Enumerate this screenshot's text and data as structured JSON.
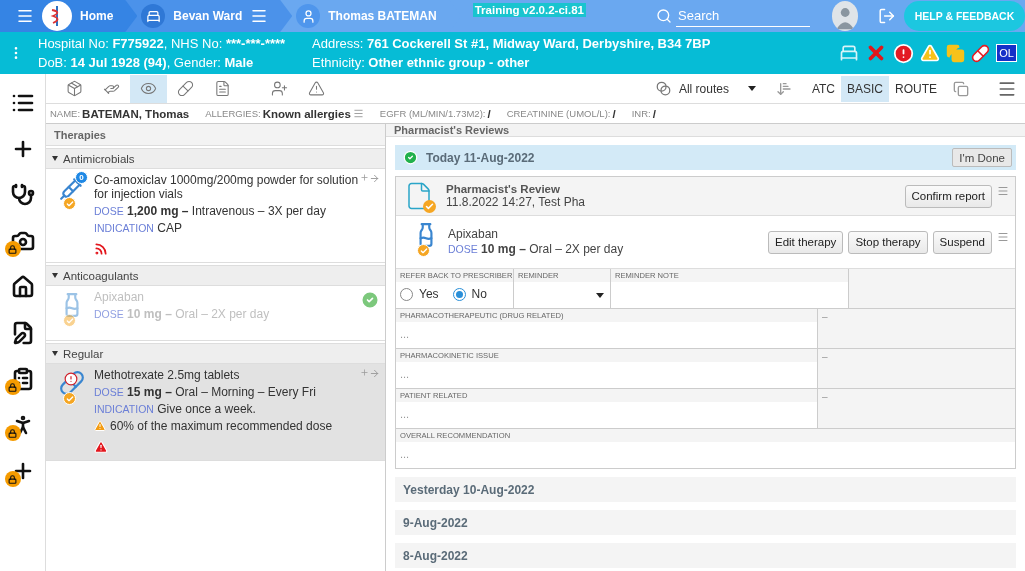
{
  "topbar": {
    "crumbs": [
      {
        "kind": "home",
        "label": "Home"
      },
      {
        "kind": "ward",
        "label": "Bevan Ward"
      },
      {
        "kind": "patient",
        "label": "Thomas BATEMAN"
      }
    ],
    "version": "Training v2.0.2-ci.81",
    "search": {
      "placeholder": "Search"
    },
    "help_button": "HELP & FEEDBACK"
  },
  "patient_bar": {
    "columns": [
      [
        [
          {
            "label": "Hospital No: ",
            "value": "F775922"
          },
          {
            "label": ", NHS No: ",
            "value": "***-***-****"
          }
        ],
        [
          {
            "label": "DoB: ",
            "value": "14 Jul 1928 (94)"
          },
          {
            "label": ", Gender: ",
            "value": "Male"
          }
        ]
      ],
      [
        [
          {
            "label": "Address: ",
            "value": "761 Cockerell St #1, Midway Ward, Derbyshire, B34 7BP"
          }
        ],
        [
          {
            "label": "Ethnicity: ",
            "value": "Other ethnic group - other"
          }
        ]
      ]
    ],
    "status_icons": [
      {
        "kind": "bed"
      },
      {
        "kind": "cross"
      },
      {
        "kind": "alert"
      },
      {
        "kind": "warning"
      },
      {
        "kind": "copies"
      },
      {
        "kind": "pill"
      },
      {
        "kind": "text",
        "label": "OL"
      }
    ]
  },
  "rail": [
    {
      "kind": "list",
      "locked": false
    },
    {
      "kind": "plus",
      "locked": false
    },
    {
      "kind": "stethoscope",
      "locked": false
    },
    {
      "kind": "camera",
      "locked": true
    },
    {
      "kind": "home",
      "locked": false
    },
    {
      "kind": "edit",
      "locked": false
    },
    {
      "kind": "clipboard",
      "locked": true
    },
    {
      "kind": "walker",
      "locked": true
    },
    {
      "kind": "plus",
      "locked": true
    }
  ],
  "toolbar": {
    "tools": [
      {
        "kind": "pillbox",
        "selected": false
      },
      {
        "kind": "hand",
        "selected": false
      },
      {
        "kind": "eye",
        "selected": true
      },
      {
        "kind": "pill",
        "selected": false
      },
      {
        "kind": "document",
        "selected": false
      },
      {
        "kind": "referral",
        "selected": false
      },
      {
        "kind": "warning",
        "selected": false
      }
    ],
    "route_filter": "All routes",
    "views": [
      {
        "label": "ATC",
        "selected": false
      },
      {
        "label": "BASIC",
        "selected": true
      },
      {
        "label": "ROUTE",
        "selected": false
      }
    ]
  },
  "info": [
    {
      "label": "NAME:",
      "value": "BATEMAN, Thomas",
      "menu": false
    },
    {
      "label": "ALLERGIES:",
      "value": "Known allergies",
      "menu": true
    },
    {
      "label": "EGFR (ML/MIN/1.73M2):",
      "value": "/",
      "menu": false
    },
    {
      "label": "CREATININE (UMOL/L):",
      "value": "/",
      "menu": false
    },
    {
      "label": "INR:",
      "value": "/",
      "menu": false
    }
  ],
  "therapies": {
    "title": "Therapies",
    "groups": [
      {
        "name": "Antimicrobials",
        "expanded": true,
        "items": [
          {
            "kind": "injection",
            "badge": "0",
            "alert": false,
            "name": "Co-amoxiclav 1000mg/200mg powder for solution for injection vials",
            "dose_label": "DOSE",
            "dose": "1,200 mg –",
            "schedule": "Intravenous – 3X per day",
            "indication_label": "INDICATION",
            "indication": "CAP",
            "flags": [
              {
                "kind": "signal"
              }
            ],
            "reviewed": false,
            "selected": false
          }
        ]
      },
      {
        "name": "Anticoagulants",
        "expanded": true,
        "items": [
          {
            "kind": "syrup",
            "alert": false,
            "name": "Apixaban",
            "dose_label": "DOSE",
            "dose": "10 mg –",
            "schedule": "Oral – 2X per day",
            "reviewed": true,
            "selected": false
          }
        ]
      },
      {
        "name": "Regular",
        "expanded": true,
        "items": [
          {
            "kind": "tablet",
            "alert": true,
            "name": "Methotrexate 2.5mg tablets",
            "dose_label": "DOSE",
            "dose": "15 mg –",
            "schedule": "Oral – Morning – Every Fri",
            "indication_label": "INDICATION",
            "indication": "Give once a week.",
            "warning": "60% of the maximum recommended dose",
            "flags": [
              {
                "kind": "warning"
              }
            ],
            "reviewed": false,
            "selected": true
          }
        ]
      }
    ]
  },
  "reviews": {
    "title": "Pharmacist's Reviews",
    "days": [
      {
        "label": "Today 11-Aug-2022",
        "expanded": true,
        "done": true,
        "done_button": "I'm Done",
        "review": {
          "title": "Pharmacist's Review",
          "meta": "11.8.2022 14:27, Test Pha",
          "confirm_button": "Confirm report",
          "medication": {
            "kind": "syrup",
            "name": "Apixaban",
            "dose_label": "DOSE",
            "dose": "10 mg –",
            "schedule": "Oral – 2X per day",
            "buttons": [
              "Edit therapy",
              "Stop therapy",
              "Suspend"
            ]
          },
          "refer": {
            "label": "REFER BACK TO PRESCRIBER",
            "options": [
              {
                "label": "Yes",
                "selected": false
              },
              {
                "label": "No",
                "selected": true
              }
            ]
          },
          "reminder": {
            "label": "REMINDER"
          },
          "reminder_note": {
            "label": "REMINDER NOTE"
          },
          "issues": [
            {
              "label": "PHARMACOTHERAPEUTIC (DRUG RELATED)",
              "placeholder": "...",
              "side": "–"
            },
            {
              "label": "PHARMACOKINETIC ISSUE",
              "placeholder": "...",
              "side": "–"
            },
            {
              "label": "PATIENT RELATED",
              "placeholder": "...",
              "side": "–"
            }
          ],
          "overall": {
            "label": "OVERALL RECOMMENDATION",
            "placeholder": "..."
          }
        }
      },
      {
        "label": "Yesterday 10-Aug-2022",
        "expanded": false,
        "done": false
      },
      {
        "label": "9-Aug-2022",
        "expanded": false,
        "done": false
      },
      {
        "label": "8-Aug-2022",
        "expanded": false,
        "done": false
      }
    ]
  }
}
